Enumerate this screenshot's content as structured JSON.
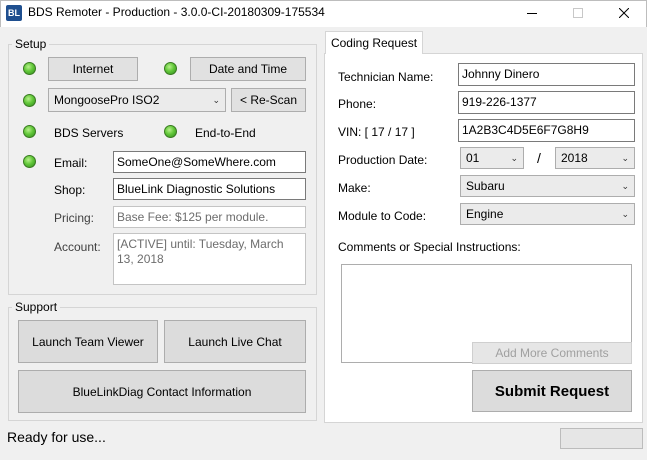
{
  "window": {
    "title": "BDS Remoter - Production - 3.0.0-CI-20180309-175534",
    "icon_text": "BL",
    "minimize_icon": "minimize-icon",
    "maximize_icon": "maximize-icon",
    "close_icon": "close-icon"
  },
  "setup": {
    "label": "Setup",
    "internet_button": "Internet",
    "datetime_button": "Date and Time",
    "device_select": "MongoosePro ISO2",
    "rescan_button": "< Re-Scan",
    "bds_servers": "BDS Servers",
    "end_to_end": "End-to-End",
    "email_label": "Email:",
    "email_value": "SomeOne@SomeWhere.com",
    "shop_label": "Shop:",
    "shop_value": "BlueLink Diagnostic Solutions",
    "pricing_label": "Pricing:",
    "pricing_value": "Base Fee: $125 per module.",
    "account_label": "Account:",
    "account_value": "[ACTIVE] until: Tuesday, March 13, 2018"
  },
  "support": {
    "label": "Support",
    "team_viewer_button": "Launch Team Viewer",
    "live_chat_button": "Launch Live Chat",
    "contact_button": "BlueLinkDiag Contact Information"
  },
  "coding_request": {
    "tab_label": "Coding Request",
    "technician_label": "Technician Name:",
    "technician_value": "Johnny Dinero",
    "phone_label": "Phone:",
    "phone_value": "919-226-1377",
    "vin_label": "VIN: [ 17 / 17 ]",
    "vin_value": "1A2B3C4D5E6F7G8H9",
    "production_date_label": "Production Date:",
    "month_value": "01",
    "date_separator": "/",
    "year_value": "2018",
    "make_label": "Make:",
    "make_value": "Subaru",
    "module_label": "Module to Code:",
    "module_value": "Engine",
    "comments_label": "Comments or Special Instructions:",
    "comments_value": "",
    "add_comments_button": "Add More Comments",
    "submit_button": "Submit Request"
  },
  "status": {
    "text": "Ready for use..."
  },
  "colors": {
    "led_green": "#63c83a",
    "window_bg": "#f0f0f0",
    "panel_bg": "#ffffff"
  }
}
